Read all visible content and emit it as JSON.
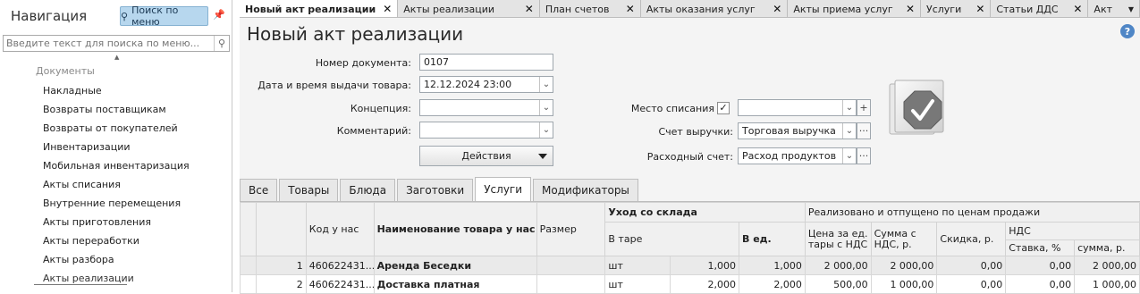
{
  "nav": {
    "title": "Навигация",
    "search_button": "Поиск по меню",
    "search_placeholder": "Введите текст для поиска по меню...",
    "section": "Документы",
    "items": [
      {
        "label": "Накладные"
      },
      {
        "label": "Возвраты поставщикам"
      },
      {
        "label": "Возвраты от покупателей"
      },
      {
        "label": "Инвентаризации"
      },
      {
        "label": "Мобильная инвентаризация"
      },
      {
        "label": "Акты списания"
      },
      {
        "label": "Внутренние перемещения"
      },
      {
        "label": "Акты приготовления"
      },
      {
        "label": "Акты переработки"
      },
      {
        "label": "Акты разбора"
      },
      {
        "label": "Акты реализации"
      }
    ]
  },
  "tabs": [
    {
      "label": "Новый акт реализации"
    },
    {
      "label": "Акты реализации"
    },
    {
      "label": "План счетов"
    },
    {
      "label": "Акты оказания услуг"
    },
    {
      "label": "Акты приема услуг"
    },
    {
      "label": "Услуги"
    },
    {
      "label": "Статьи ДДС"
    },
    {
      "label": "Акт"
    }
  ],
  "page": {
    "title": "Новый акт реализации",
    "help": "?"
  },
  "form": {
    "doc_number_label": "Номер документа:",
    "doc_number": "0107",
    "date_label": "Дата и время выдачи товара:",
    "date": "12.12.2024 23:00",
    "concept_label": "Концепция:",
    "concept": "",
    "comment_label": "Комментарий:",
    "comment": "",
    "actions_label": "Действия",
    "writeoff_label": "Место списания",
    "writeoff_checked": "✓",
    "writeoff_value": "",
    "revenue_label": "Счет выручки:",
    "revenue": "Торговая выручка",
    "expense_label": "Расходный счет:",
    "expense": "Расход продуктов"
  },
  "subtabs": [
    {
      "label": "Все"
    },
    {
      "label": "Товары"
    },
    {
      "label": "Блюда"
    },
    {
      "label": "Заготовки"
    },
    {
      "label": "Услуги"
    },
    {
      "label": "Модификаторы"
    }
  ],
  "grid": {
    "headers": {
      "code": "Код у нас",
      "name": "Наименование товара у нас",
      "size": "Размер",
      "out": "Уход со склада",
      "in_pack": "В таре",
      "in_units": "В ед.",
      "realized": "Реализовано и отпущено по ценам продажи",
      "price": "Цена за ед. тары с НДС",
      "sum_vat": "Сумма с НДС, р.",
      "discount": "Скидка, р.",
      "vat": "НДС",
      "rate": "Ставка, %",
      "vat_sum": "сумма, р."
    },
    "rows": [
      {
        "n": "1",
        "code": "460622431...",
        "name": "Аренда Беседки",
        "size": "",
        "unit": "шт",
        "qty": "1,000",
        "units": "1,000",
        "price": "2 000,00",
        "sum": "2 000,00",
        "disc": "0,00",
        "rate": "0,00",
        "vatsum": "2 000,00"
      },
      {
        "n": "2",
        "code": "460622431...",
        "name": "Доставка платная",
        "size": "",
        "unit": "шт",
        "qty": "2,000",
        "units": "2,000",
        "price": "500,00",
        "sum": "1 000,00",
        "disc": "0,00",
        "rate": "0,00",
        "vatsum": "1 000,00"
      }
    ]
  },
  "colors": {
    "nav_button": "#b7d7ee",
    "help": "#4f86c6"
  }
}
